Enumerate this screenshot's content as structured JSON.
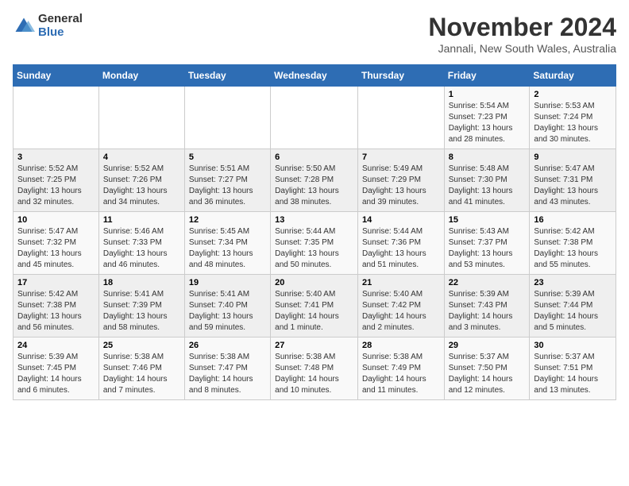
{
  "header": {
    "logo_general": "General",
    "logo_blue": "Blue",
    "title": "November 2024",
    "subtitle": "Jannali, New South Wales, Australia"
  },
  "weekdays": [
    "Sunday",
    "Monday",
    "Tuesday",
    "Wednesday",
    "Thursday",
    "Friday",
    "Saturday"
  ],
  "weeks": [
    [
      {
        "day": "",
        "info": ""
      },
      {
        "day": "",
        "info": ""
      },
      {
        "day": "",
        "info": ""
      },
      {
        "day": "",
        "info": ""
      },
      {
        "day": "",
        "info": ""
      },
      {
        "day": "1",
        "info": "Sunrise: 5:54 AM\nSunset: 7:23 PM\nDaylight: 13 hours and 28 minutes."
      },
      {
        "day": "2",
        "info": "Sunrise: 5:53 AM\nSunset: 7:24 PM\nDaylight: 13 hours and 30 minutes."
      }
    ],
    [
      {
        "day": "3",
        "info": "Sunrise: 5:52 AM\nSunset: 7:25 PM\nDaylight: 13 hours and 32 minutes."
      },
      {
        "day": "4",
        "info": "Sunrise: 5:52 AM\nSunset: 7:26 PM\nDaylight: 13 hours and 34 minutes."
      },
      {
        "day": "5",
        "info": "Sunrise: 5:51 AM\nSunset: 7:27 PM\nDaylight: 13 hours and 36 minutes."
      },
      {
        "day": "6",
        "info": "Sunrise: 5:50 AM\nSunset: 7:28 PM\nDaylight: 13 hours and 38 minutes."
      },
      {
        "day": "7",
        "info": "Sunrise: 5:49 AM\nSunset: 7:29 PM\nDaylight: 13 hours and 39 minutes."
      },
      {
        "day": "8",
        "info": "Sunrise: 5:48 AM\nSunset: 7:30 PM\nDaylight: 13 hours and 41 minutes."
      },
      {
        "day": "9",
        "info": "Sunrise: 5:47 AM\nSunset: 7:31 PM\nDaylight: 13 hours and 43 minutes."
      }
    ],
    [
      {
        "day": "10",
        "info": "Sunrise: 5:47 AM\nSunset: 7:32 PM\nDaylight: 13 hours and 45 minutes."
      },
      {
        "day": "11",
        "info": "Sunrise: 5:46 AM\nSunset: 7:33 PM\nDaylight: 13 hours and 46 minutes."
      },
      {
        "day": "12",
        "info": "Sunrise: 5:45 AM\nSunset: 7:34 PM\nDaylight: 13 hours and 48 minutes."
      },
      {
        "day": "13",
        "info": "Sunrise: 5:44 AM\nSunset: 7:35 PM\nDaylight: 13 hours and 50 minutes."
      },
      {
        "day": "14",
        "info": "Sunrise: 5:44 AM\nSunset: 7:36 PM\nDaylight: 13 hours and 51 minutes."
      },
      {
        "day": "15",
        "info": "Sunrise: 5:43 AM\nSunset: 7:37 PM\nDaylight: 13 hours and 53 minutes."
      },
      {
        "day": "16",
        "info": "Sunrise: 5:42 AM\nSunset: 7:38 PM\nDaylight: 13 hours and 55 minutes."
      }
    ],
    [
      {
        "day": "17",
        "info": "Sunrise: 5:42 AM\nSunset: 7:38 PM\nDaylight: 13 hours and 56 minutes."
      },
      {
        "day": "18",
        "info": "Sunrise: 5:41 AM\nSunset: 7:39 PM\nDaylight: 13 hours and 58 minutes."
      },
      {
        "day": "19",
        "info": "Sunrise: 5:41 AM\nSunset: 7:40 PM\nDaylight: 13 hours and 59 minutes."
      },
      {
        "day": "20",
        "info": "Sunrise: 5:40 AM\nSunset: 7:41 PM\nDaylight: 14 hours and 1 minute."
      },
      {
        "day": "21",
        "info": "Sunrise: 5:40 AM\nSunset: 7:42 PM\nDaylight: 14 hours and 2 minutes."
      },
      {
        "day": "22",
        "info": "Sunrise: 5:39 AM\nSunset: 7:43 PM\nDaylight: 14 hours and 3 minutes."
      },
      {
        "day": "23",
        "info": "Sunrise: 5:39 AM\nSunset: 7:44 PM\nDaylight: 14 hours and 5 minutes."
      }
    ],
    [
      {
        "day": "24",
        "info": "Sunrise: 5:39 AM\nSunset: 7:45 PM\nDaylight: 14 hours and 6 minutes."
      },
      {
        "day": "25",
        "info": "Sunrise: 5:38 AM\nSunset: 7:46 PM\nDaylight: 14 hours and 7 minutes."
      },
      {
        "day": "26",
        "info": "Sunrise: 5:38 AM\nSunset: 7:47 PM\nDaylight: 14 hours and 8 minutes."
      },
      {
        "day": "27",
        "info": "Sunrise: 5:38 AM\nSunset: 7:48 PM\nDaylight: 14 hours and 10 minutes."
      },
      {
        "day": "28",
        "info": "Sunrise: 5:38 AM\nSunset: 7:49 PM\nDaylight: 14 hours and 11 minutes."
      },
      {
        "day": "29",
        "info": "Sunrise: 5:37 AM\nSunset: 7:50 PM\nDaylight: 14 hours and 12 minutes."
      },
      {
        "day": "30",
        "info": "Sunrise: 5:37 AM\nSunset: 7:51 PM\nDaylight: 14 hours and 13 minutes."
      }
    ]
  ]
}
